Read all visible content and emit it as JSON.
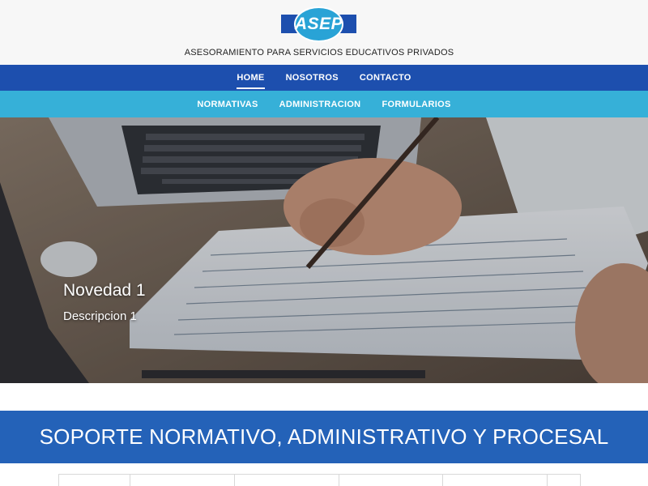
{
  "brand": {
    "logo_text": "ASEP",
    "tagline": "ASESORAMIENTO PARA SERVICIOS EDUCATIVOS PRIVADOS",
    "colors": {
      "primary": "#1d4fae",
      "secondary": "#36b0d8",
      "banner": "#2462b8"
    }
  },
  "nav_primary": {
    "items": [
      {
        "label": "HOME",
        "active": true
      },
      {
        "label": "NOSOTROS",
        "active": false
      },
      {
        "label": "CONTACTO",
        "active": false
      }
    ]
  },
  "nav_secondary": {
    "items": [
      {
        "label": "NORMATIVAS"
      },
      {
        "label": "ADMINISTRACION"
      },
      {
        "label": "FORMULARIOS"
      }
    ]
  },
  "hero": {
    "title": "Novedad 1",
    "description": "Descripcion 1"
  },
  "banner": {
    "title": "SOPORTE NORMATIVO, ADMINISTRATIVO Y PROCESAL"
  }
}
